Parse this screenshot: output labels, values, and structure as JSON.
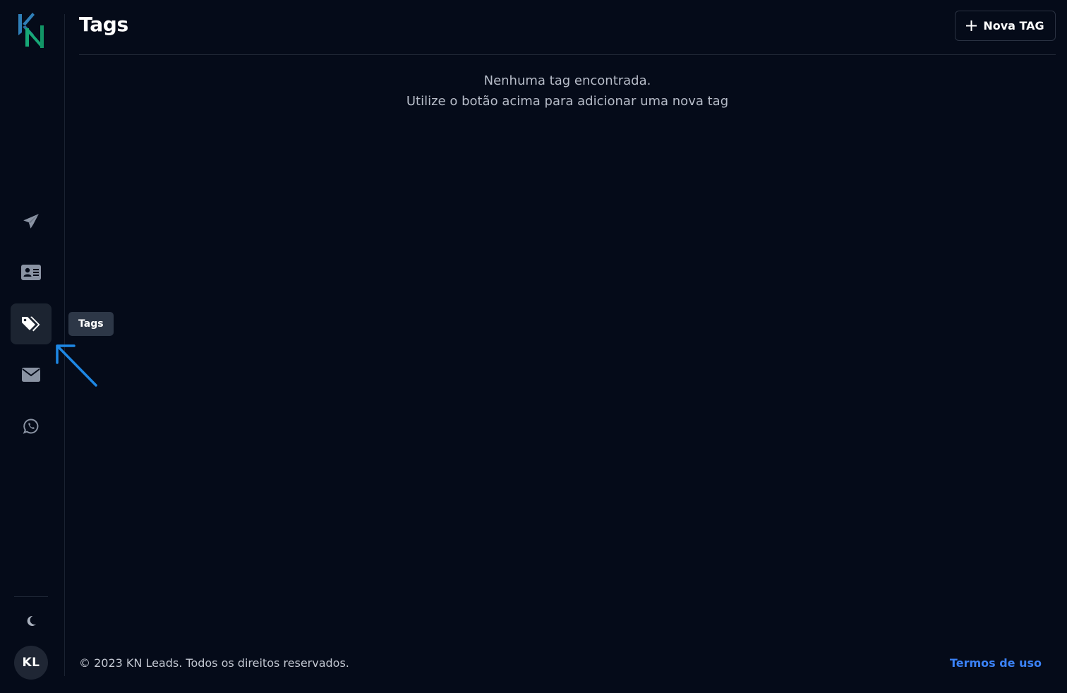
{
  "app": {
    "brand": "KN"
  },
  "header": {
    "title": "Tags",
    "new_tag_label": "Nova TAG"
  },
  "sidebar": {
    "items": [
      {
        "name": "campaigns",
        "icon": "paper-plane-icon"
      },
      {
        "name": "contacts",
        "icon": "address-card-icon"
      },
      {
        "name": "tags",
        "icon": "tags-icon",
        "active": true,
        "tooltip": "Tags"
      },
      {
        "name": "email",
        "icon": "envelope-icon"
      },
      {
        "name": "whatsapp",
        "icon": "whatsapp-icon"
      }
    ],
    "theme_icon": "moon-icon",
    "avatar_initials": "KL"
  },
  "empty_state": {
    "line1": "Nenhuma tag encontrada.",
    "line2": "Utilize o botão acima para adicionar uma nova tag"
  },
  "footer": {
    "copyright": "© 2023 KN Leads. Todos os direitos reservados.",
    "terms_label": "Termos de uso"
  },
  "colors": {
    "background": "#050b19",
    "accent": "#3b82f6",
    "logo_blue": "#2f7fb8",
    "logo_green": "#17a877",
    "annotation_arrow": "#1e88e5"
  }
}
